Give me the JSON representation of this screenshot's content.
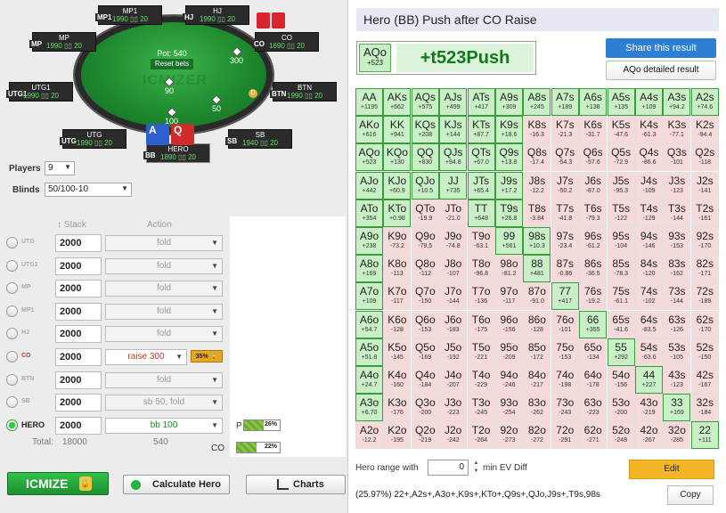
{
  "table": {
    "pot": "Pot: 540",
    "reset": "Reset bets",
    "watermark": "ICMIZER",
    "chips": {
      "btn_bet": "50",
      "co_bet": "300",
      "mp_bet": "90",
      "hero_bet": "100"
    },
    "dealer": "D",
    "seats": [
      {
        "pos": "MP1",
        "name": "MP1",
        "stack": "1990"
      },
      {
        "pos": "HJ",
        "name": "HJ",
        "stack": "1990"
      },
      {
        "pos": "MP",
        "name": "MP",
        "stack": "1990"
      },
      {
        "pos": "CO",
        "name": "CO",
        "stack": "1690"
      },
      {
        "pos": "UTG1",
        "name": "UTG1",
        "stack": "1990"
      },
      {
        "pos": "BTN",
        "name": "BTN",
        "stack": "1990"
      },
      {
        "pos": "UTG",
        "name": "UTG",
        "stack": "1990"
      },
      {
        "pos": "SB",
        "name": "SB",
        "stack": "1940"
      },
      {
        "pos": "BB",
        "name": "HERO",
        "stack": "1890"
      }
    ],
    "hero_cards": [
      "A",
      "Q"
    ],
    "seat_suffix": "20"
  },
  "controls": {
    "players_label": "Players",
    "players_value": "9",
    "blinds_label": "Blinds",
    "blinds_value": "50/100-10",
    "stack_header": "Stack",
    "action_header": "Action"
  },
  "players": [
    {
      "pos": "UTG",
      "stack": "2000",
      "action": "fold",
      "style": ""
    },
    {
      "pos": "UTG1",
      "stack": "2000",
      "action": "fold",
      "style": ""
    },
    {
      "pos": "MP",
      "stack": "2000",
      "action": "fold",
      "style": ""
    },
    {
      "pos": "MP1",
      "stack": "2000",
      "action": "fold",
      "style": ""
    },
    {
      "pos": "HJ",
      "stack": "2000",
      "action": "fold",
      "style": ""
    },
    {
      "pos": "CO",
      "stack": "2000",
      "action": "raise 300",
      "style": "raise"
    },
    {
      "pos": "BTN",
      "stack": "2000",
      "action": "fold",
      "style": ""
    },
    {
      "pos": "SB",
      "stack": "2000",
      "action": "sb 50, fold",
      "style": ""
    },
    {
      "pos": "HERO",
      "stack": "2000",
      "action": "bb 100",
      "style": "hero"
    }
  ],
  "co_mini_pct": "35%",
  "totals": {
    "label": "Total:",
    "stack": "18000",
    "action": "540"
  },
  "bars": [
    {
      "label": "P",
      "pct": "26%",
      "fill": 0.26
    },
    {
      "label": "CO",
      "pct": "22%",
      "fill": 0.22
    }
  ],
  "buttons": {
    "icmize": "ICMIZE",
    "calc": "Calculate Hero",
    "charts": "Charts"
  },
  "result": {
    "title": "Hero (BB) Push after CO Raise",
    "hand": "AQo",
    "hand_ev": "+523",
    "decision": "+t523Push",
    "share": "Share this result",
    "detail": "AQo detailed result",
    "hero_range_label": "Hero range with",
    "min_ev_value": "0",
    "min_ev_label": "min EV Diff",
    "edit": "Edit",
    "range_text": "(25.97%) 22+,A2s+,A3o+,K9s+,KTo+,Q9s+,QJo,J9s+,T9s,98s",
    "copy": "Copy"
  },
  "grid": [
    [
      [
        "AA",
        "+1195",
        1
      ],
      [
        "AKs",
        "+662",
        1
      ],
      [
        "AQs",
        "+575",
        1
      ],
      [
        "AJs",
        "+499",
        1
      ],
      [
        "ATs",
        "+417",
        1
      ],
      [
        "A9s",
        "+309",
        1
      ],
      [
        "A8s",
        "+245",
        1
      ],
      [
        "A7s",
        "+189",
        1
      ],
      [
        "A6s",
        "+138",
        1
      ],
      [
        "A5s",
        "+135",
        1
      ],
      [
        "A4s",
        "+109",
        1
      ],
      [
        "A3s",
        "+94.2",
        1
      ],
      [
        "A2s",
        "+74.6",
        1
      ]
    ],
    [
      [
        "AKo",
        "+616",
        1
      ],
      [
        "KK",
        "+941",
        1
      ],
      [
        "KQs",
        "+208",
        1
      ],
      [
        "KJs",
        "+144",
        1
      ],
      [
        "KTs",
        "+87.7",
        1
      ],
      [
        "K9s",
        "+18.6",
        1
      ],
      [
        "K8s",
        "-16.3",
        0
      ],
      [
        "K7s",
        "-21.3",
        0
      ],
      [
        "K6s",
        "-31.7",
        0
      ],
      [
        "K5s",
        "-47.6",
        0
      ],
      [
        "K4s",
        "-61.3",
        0
      ],
      [
        "K3s",
        "-77.1",
        0
      ],
      [
        "K2s",
        "-94.4",
        0
      ]
    ],
    [
      [
        "AQo",
        "+523",
        1
      ],
      [
        "KQo",
        "+130",
        1
      ],
      [
        "QQ",
        "+830",
        1
      ],
      [
        "QJs",
        "+94.8",
        1
      ],
      [
        "QTs",
        "+67.0",
        1
      ],
      [
        "Q9s",
        "+13.8",
        1
      ],
      [
        "Q8s",
        "-17.4",
        0
      ],
      [
        "Q7s",
        "-54.3",
        0
      ],
      [
        "Q6s",
        "-57.6",
        0
      ],
      [
        "Q5s",
        "-72.9",
        0
      ],
      [
        "Q4s",
        "-86.6",
        0
      ],
      [
        "Q3s",
        "-101",
        0
      ],
      [
        "Q2s",
        "-118",
        0
      ]
    ],
    [
      [
        "AJo",
        "+442",
        1
      ],
      [
        "KJo",
        "+60.9",
        1
      ],
      [
        "QJo",
        "+10.5",
        1
      ],
      [
        "JJ",
        "+735",
        1
      ],
      [
        "JTs",
        "+65.4",
        1
      ],
      [
        "J9s",
        "+17.2",
        1
      ],
      [
        "J8s",
        "-12.2",
        0
      ],
      [
        "J7s",
        "-50.2",
        0
      ],
      [
        "J6s",
        "-87.0",
        0
      ],
      [
        "J5s",
        "-95.3",
        0
      ],
      [
        "J4s",
        "-109",
        0
      ],
      [
        "J3s",
        "-123",
        0
      ],
      [
        "J2s",
        "-141",
        0
      ]
    ],
    [
      [
        "ATo",
        "+354",
        1
      ],
      [
        "KTo",
        "+0.98",
        1
      ],
      [
        "QTo",
        "-19.9",
        0
      ],
      [
        "JTo",
        "-21.0",
        0
      ],
      [
        "TT",
        "+648",
        1
      ],
      [
        "T9s",
        "+26.8",
        1
      ],
      [
        "T8s",
        "-3.84",
        0
      ],
      [
        "T7s",
        "-41.8",
        0
      ],
      [
        "T6s",
        "-79.3",
        0
      ],
      [
        "T5s",
        "-122",
        0
      ],
      [
        "T4s",
        "-129",
        0
      ],
      [
        "T3s",
        "-144",
        0
      ],
      [
        "T2s",
        "-161",
        0
      ]
    ],
    [
      [
        "A9o",
        "+238",
        1
      ],
      [
        "K9o",
        "-73.2",
        0
      ],
      [
        "Q9o",
        "-79.5",
        0
      ],
      [
        "J9o",
        "-74.8",
        0
      ],
      [
        "T9o",
        "-63.1",
        0
      ],
      [
        "99",
        "+561",
        1
      ],
      [
        "98s",
        "+10.3",
        1
      ],
      [
        "97s",
        "-23.4",
        0
      ],
      [
        "96s",
        "-61.2",
        0
      ],
      [
        "95s",
        "-104",
        0
      ],
      [
        "94s",
        "-146",
        0
      ],
      [
        "93s",
        "-153",
        0
      ],
      [
        "92s",
        "-170",
        0
      ]
    ],
    [
      [
        "A8o",
        "+169",
        1
      ],
      [
        "K8o",
        "-113",
        0
      ],
      [
        "Q8o",
        "-112",
        0
      ],
      [
        "J8o",
        "-107",
        0
      ],
      [
        "T8o",
        "-96.8",
        0
      ],
      [
        "98o",
        "-81.2",
        0
      ],
      [
        "88",
        "+481",
        1
      ],
      [
        "87s",
        "-0.86",
        0
      ],
      [
        "86s",
        "-36.5",
        0
      ],
      [
        "85s",
        "-78.3",
        0
      ],
      [
        "84s",
        "-120",
        0
      ],
      [
        "83s",
        "-162",
        0
      ],
      [
        "82s",
        "-171",
        0
      ]
    ],
    [
      [
        "A7o",
        "+109",
        1
      ],
      [
        "K7o",
        "-117",
        0
      ],
      [
        "Q7o",
        "-150",
        0
      ],
      [
        "J7o",
        "-144",
        0
      ],
      [
        "T7o",
        "-136",
        0
      ],
      [
        "97o",
        "-117",
        0
      ],
      [
        "87o",
        "-91.0",
        0
      ],
      [
        "77",
        "+417",
        1
      ],
      [
        "76s",
        "-19.2",
        0
      ],
      [
        "75s",
        "-61.1",
        0
      ],
      [
        "74s",
        "-102",
        0
      ],
      [
        "73s",
        "-144",
        0
      ],
      [
        "72s",
        "-189",
        0
      ]
    ],
    [
      [
        "A6o",
        "+54.7",
        1
      ],
      [
        "K6o",
        "-128",
        0
      ],
      [
        "Q6o",
        "-153",
        0
      ],
      [
        "J6o",
        "-183",
        0
      ],
      [
        "T6o",
        "-175",
        0
      ],
      [
        "96o",
        "-156",
        0
      ],
      [
        "86o",
        "-128",
        0
      ],
      [
        "76o",
        "-101",
        0
      ],
      [
        "66",
        "+355",
        1
      ],
      [
        "65s",
        "-41.6",
        0
      ],
      [
        "64s",
        "-83.5",
        0
      ],
      [
        "63s",
        "-126",
        0
      ],
      [
        "62s",
        "-170",
        0
      ]
    ],
    [
      [
        "A5o",
        "+51.8",
        1
      ],
      [
        "K5o",
        "-145",
        0
      ],
      [
        "Q5o",
        "-169",
        0
      ],
      [
        "J5o",
        "-192",
        0
      ],
      [
        "T5o",
        "-221",
        0
      ],
      [
        "95o",
        "-209",
        0
      ],
      [
        "85o",
        "-172",
        0
      ],
      [
        "75o",
        "-153",
        0
      ],
      [
        "65o",
        "-134",
        0
      ],
      [
        "55",
        "+292",
        1
      ],
      [
        "54s",
        "-63.6",
        0
      ],
      [
        "53s",
        "-105",
        0
      ],
      [
        "52s",
        "-150",
        0
      ]
    ],
    [
      [
        "A4o",
        "+24.7",
        1
      ],
      [
        "K4o",
        "-160",
        0
      ],
      [
        "Q4o",
        "-184",
        0
      ],
      [
        "J4o",
        "-207",
        0
      ],
      [
        "T4o",
        "-229",
        0
      ],
      [
        "94o",
        "-246",
        0
      ],
      [
        "84o",
        "-217",
        0
      ],
      [
        "74o",
        "-198",
        0
      ],
      [
        "64o",
        "-178",
        0
      ],
      [
        "54o",
        "-156",
        0
      ],
      [
        "44",
        "+227",
        1
      ],
      [
        "43s",
        "-123",
        0
      ],
      [
        "42s",
        "-167",
        0
      ]
    ],
    [
      [
        "A3o",
        "+6.70",
        1
      ],
      [
        "K3o",
        "-176",
        0
      ],
      [
        "Q3o",
        "-200",
        0
      ],
      [
        "J3o",
        "-223",
        0
      ],
      [
        "T3o",
        "-245",
        0
      ],
      [
        "93o",
        "-254",
        0
      ],
      [
        "83o",
        "-262",
        0
      ],
      [
        "73o",
        "-243",
        0
      ],
      [
        "63o",
        "-223",
        0
      ],
      [
        "53o",
        "-200",
        0
      ],
      [
        "43o",
        "-219",
        0
      ],
      [
        "33",
        "+169",
        1
      ],
      [
        "32s",
        "-184",
        0
      ]
    ],
    [
      [
        "A2o",
        "-12.2",
        0
      ],
      [
        "K2o",
        "-195",
        0
      ],
      [
        "Q2o",
        "-219",
        0
      ],
      [
        "J2o",
        "-242",
        0
      ],
      [
        "T2o",
        "-264",
        0
      ],
      [
        "92o",
        "-273",
        0
      ],
      [
        "82o",
        "-272",
        0
      ],
      [
        "72o",
        "-291",
        0
      ],
      [
        "62o",
        "-271",
        0
      ],
      [
        "52o",
        "-248",
        0
      ],
      [
        "42o",
        "-267",
        0
      ],
      [
        "32o",
        "-285",
        0
      ],
      [
        "22",
        "+111",
        1
      ]
    ]
  ]
}
